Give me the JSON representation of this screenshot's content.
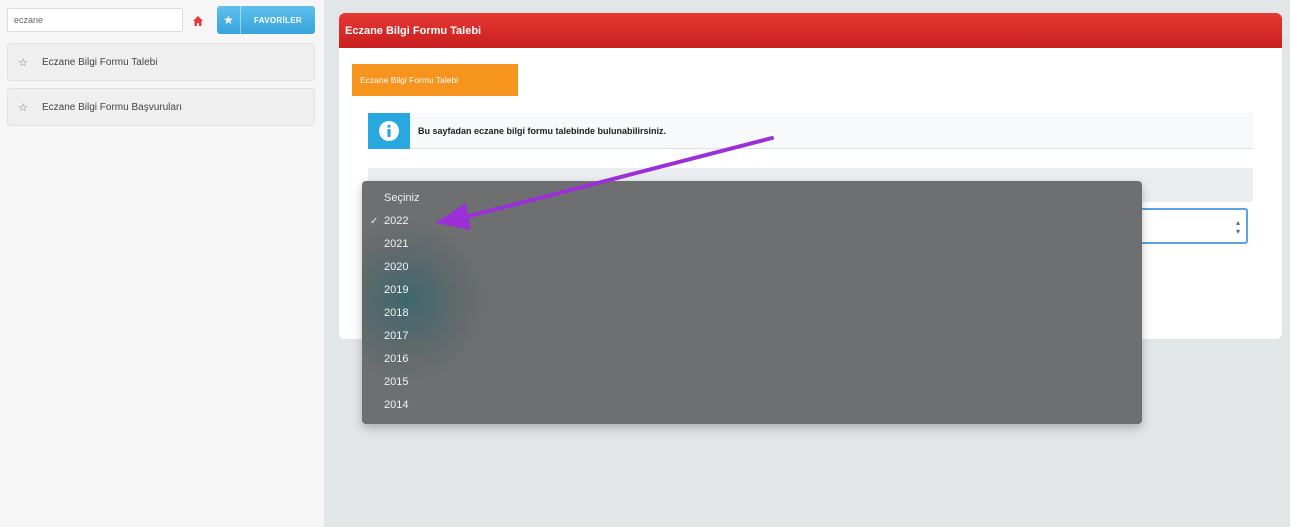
{
  "sidebar": {
    "search": {
      "value": "eczane",
      "placeholder": ""
    },
    "favorites_label": "FAVORİLER",
    "items": [
      {
        "label": "Eczane Bilgi Formu Talebi"
      },
      {
        "label": "Eczane Bilgi Formu Başvuruları"
      }
    ]
  },
  "panel": {
    "title": "Eczane Bilgi Formu Talebi",
    "tab_label": "Eczane Bilgi Formu Talebi",
    "info_text": "Bu sayfadan eczane bilgi formu talebinde bulunabilirsiniz."
  },
  "dropdown": {
    "selected": "2022",
    "options": [
      "Seçiniz",
      "2022",
      "2021",
      "2020",
      "2019",
      "2018",
      "2017",
      "2016",
      "2015",
      "2014"
    ]
  },
  "colors": {
    "header_red": "#d32f2f",
    "tab_orange": "#f7941d",
    "info_blue": "#29a8e0",
    "annotation_purple": "#9b30d9"
  }
}
